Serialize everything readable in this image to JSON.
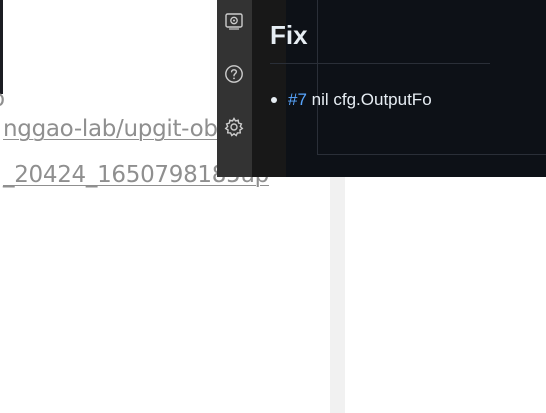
{
  "background": {
    "stray_char": "o",
    "link1": "nggao-lab/upgit-ob",
    "link2": "_20424_1650798185up"
  },
  "overlay": {
    "activity_bar": {
      "icons": [
        "remote-explorer-icon",
        "help-icon",
        "settings-gear-icon"
      ]
    },
    "release_notes": {
      "heading": "Fix",
      "items": [
        {
          "issue": "#7",
          "text": " nil cfg.OutputFo"
        }
      ]
    }
  },
  "colors": {
    "link_gray": "#8f8f8f",
    "overlay_bg": "#0d1117",
    "activity_bar": "#333333",
    "accent_link": "#58a6ff",
    "text_light": "#e6edf3"
  }
}
